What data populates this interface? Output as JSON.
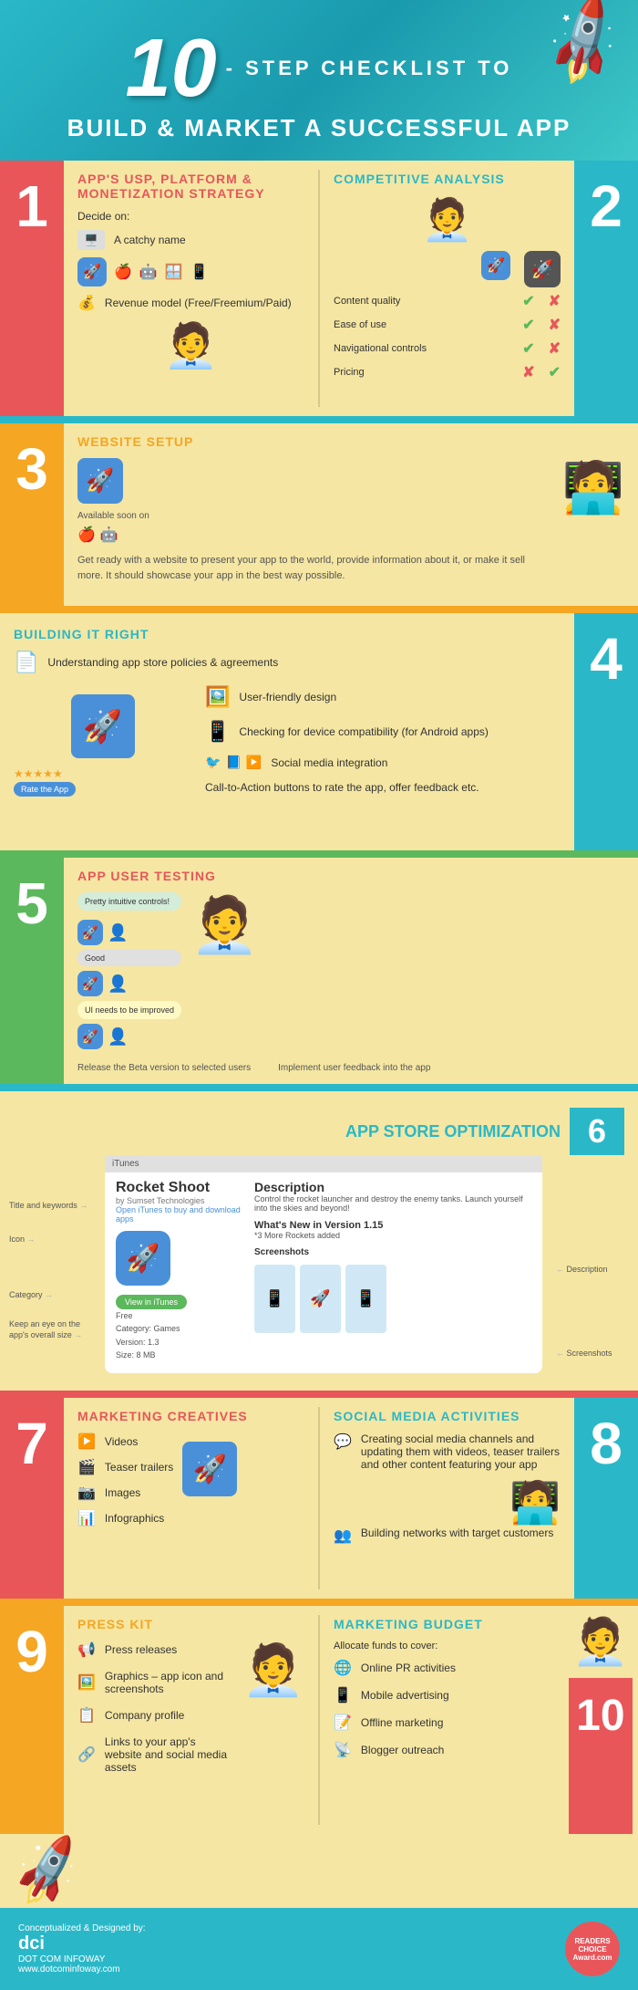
{
  "header": {
    "ten": "10",
    "step_label": "- STEP CHECKLIST TO",
    "build_label": "BUILD & MARKET A SUCCESSFUL APP"
  },
  "step1": {
    "number": "1",
    "title": "APP'S USP, PLATFORM &",
    "title2": "MONETIZATION STRATEGY",
    "decide_on": "Decide on:",
    "items": [
      {
        "icon": "🖥️",
        "text": "A catchy name"
      },
      {
        "icon": "📱",
        "text": ""
      },
      {
        "icon": "💰",
        "text": "Revenue model (Free/Freemium/Paid)"
      }
    ]
  },
  "step2": {
    "number": "2",
    "title": "COMPETITIVE ANALYSIS",
    "avatar1_icon": "🚀",
    "avatar2_icon": "🚀",
    "criteria": [
      {
        "label": "Content quality",
        "check1": "✔",
        "check2": "✘"
      },
      {
        "label": "Ease of use",
        "check1": "✔",
        "check2": "✘"
      },
      {
        "label": "Navigational controls",
        "check1": "✔",
        "check2": "✘"
      },
      {
        "label": "Pricing",
        "check1": "✘",
        "check2": "✔"
      }
    ]
  },
  "step3": {
    "number": "3",
    "title": "WEBSITE SETUP",
    "available_soon": "Available soon on",
    "body_text": "Get ready with a website to present your app to the world, provide information about it, or make it sell more. It should showcase your app in the best way possible."
  },
  "step4": {
    "number": "4",
    "title": "BUILDING IT RIGHT",
    "items": [
      {
        "icon": "📄",
        "text": "Understanding app store policies & agreements"
      },
      {
        "icon": "🖼️",
        "text": "User-friendly design"
      },
      {
        "icon": "📱",
        "text": "Checking for device compatibility (for Android apps)"
      },
      {
        "icon": "🐦",
        "text": "Social media integration"
      },
      {
        "icon": "⭐",
        "text": "Call-to-Action buttons to rate the app, offer feedback etc."
      }
    ],
    "rate_btn": "Rate the App"
  },
  "step5": {
    "number": "5",
    "title": "APP USER TESTING",
    "feedback": [
      "Pretty intuitive controls!",
      "Good",
      "UI needs to be improved"
    ],
    "beta_text": "Release the Beta version to selected users",
    "implement_text": "Implement user feedback into the app"
  },
  "step6": {
    "number": "6",
    "title": "APP STORE OPTIMIZATION",
    "itunes_header": "iTunes",
    "app_name": "Rocket Shoot",
    "app_by": "by Sumset Technologies",
    "open_link": "Open iTunes to buy and download apps",
    "description_title": "Description",
    "description_text": "Control the rocket launcher and destroy the enemy tanks. Launch yourself into the skies and beyond!",
    "whats_new": "What's New in Version 1.15",
    "more_rockets": "*3 More Rockets added",
    "screenshots_label": "Screenshots",
    "view_btn": "View in iTunes",
    "category": "Free",
    "category_label": "Category: Games",
    "version": "Version: 1.3",
    "size": "Size: 8 MB",
    "labels_left": [
      "Title and keywords",
      "Icon",
      "Category",
      "Keep an eye on the app's overall size"
    ],
    "labels_right": [
      "Description",
      "Screenshots"
    ]
  },
  "step7": {
    "number": "7",
    "title": "MARKETING CREATIVES",
    "items": [
      {
        "icon": "▶️",
        "text": "Videos"
      },
      {
        "icon": "🎬",
        "text": "Teaser trailers"
      },
      {
        "icon": "📷",
        "text": "Images"
      },
      {
        "icon": "📊",
        "text": "Infographics"
      }
    ]
  },
  "step8": {
    "number": "8",
    "title": "SOCIAL MEDIA ACTIVITIES",
    "items": [
      {
        "icon": "💬",
        "text": "Creating social media channels and updating them with videos, teaser trailers and other content featuring your app"
      },
      {
        "icon": "👥",
        "text": "Building networks with target customers"
      }
    ]
  },
  "step9": {
    "number": "9",
    "title": "PRESS KIT",
    "items": [
      {
        "icon": "📢",
        "text": "Press releases"
      },
      {
        "icon": "🖼️",
        "text": "Graphics – app icon and screenshots"
      },
      {
        "icon": "📋",
        "text": "Company profile"
      },
      {
        "icon": "🔗",
        "text": "Links to your app's website and social media assets"
      }
    ]
  },
  "step10": {
    "number": "10",
    "title": "MARKETING BUDGET",
    "allocate": "Allocate funds to cover:",
    "items": [
      {
        "icon": "🌐",
        "text": "Online PR activities"
      },
      {
        "icon": "📱",
        "text": "Mobile advertising"
      },
      {
        "icon": "📝",
        "text": "Offline marketing"
      },
      {
        "icon": "📡",
        "text": "Blogger outreach"
      }
    ]
  },
  "footer": {
    "conceptualized": "Conceptualized & Designed by:",
    "logo": "dci",
    "company": "DOT COM INFOWAY",
    "website": "www.dotcominfoway.com",
    "badge_text": "READERS CHOICE Award.com"
  }
}
